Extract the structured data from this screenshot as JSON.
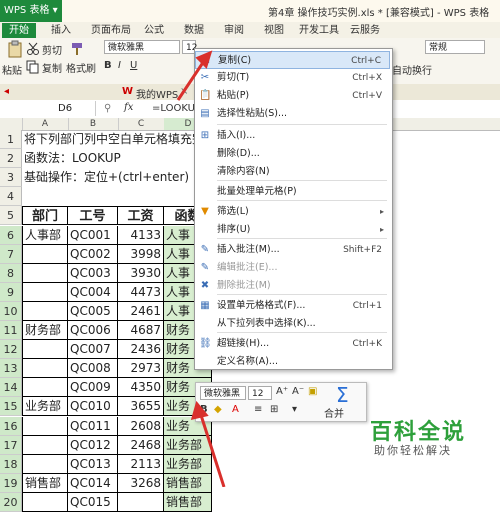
{
  "app": {
    "logo": "WPS 表格",
    "title": "第4章 操作技巧实例.xls * [兼容模式] - WPS 表格"
  },
  "tabs": [
    "开始",
    "插入",
    "页面布局",
    "公式",
    "数据",
    "审阅",
    "视图",
    "开发工具",
    "云服务"
  ],
  "ribbon": {
    "cut": "剪切",
    "paste": "粘贴",
    "copy": "复制",
    "format_painter": "格式刷",
    "font": "微软雅黑",
    "size": "12",
    "number_format": "常规",
    "auto_wrap": "自动换行"
  },
  "docbar": {
    "tab": "我的WPS"
  },
  "formula_bar": {
    "cell_ref": "D6",
    "fx": "fx",
    "formula": "=LOOKUP"
  },
  "columns": [
    "A",
    "B",
    "C",
    "D"
  ],
  "rows": [
    "1",
    "2",
    "3",
    "4",
    "5",
    "6",
    "7",
    "8",
    "9",
    "10",
    "11",
    "12",
    "13",
    "14",
    "15",
    "16",
    "17",
    "18",
    "19",
    "20"
  ],
  "notes": {
    "line1": "将下列部门列中空白单元格填充完成",
    "line2": "函数法：LOOKUP",
    "line3": "基础操作：定位+(ctrl+enter)"
  },
  "table": {
    "headers": [
      "部门",
      "工号",
      "工资",
      "函数"
    ],
    "rows": [
      [
        "人事部",
        "QC001",
        "4133",
        "人事"
      ],
      [
        "",
        "QC002",
        "3998",
        "人事"
      ],
      [
        "",
        "QC003",
        "3930",
        "人事"
      ],
      [
        "",
        "QC004",
        "4473",
        "人事"
      ],
      [
        "",
        "QC005",
        "2461",
        "人事"
      ],
      [
        "财务部",
        "QC006",
        "4687",
        "财务"
      ],
      [
        "",
        "QC007",
        "2436",
        "财务"
      ],
      [
        "",
        "QC008",
        "2973",
        "财务"
      ],
      [
        "",
        "QC009",
        "4350",
        "财务"
      ],
      [
        "业务部",
        "QC010",
        "3655",
        "业务"
      ],
      [
        "",
        "QC011",
        "2608",
        "业务"
      ],
      [
        "",
        "QC012",
        "2468",
        "业务部"
      ],
      [
        "",
        "QC013",
        "2113",
        "业务部"
      ],
      [
        "销售部",
        "QC014",
        "3268",
        "销售部"
      ],
      [
        "",
        "QC015",
        "",
        "销售部"
      ]
    ]
  },
  "context_menu": {
    "items": [
      {
        "label": "复制(C)",
        "shortcut": "Ctrl+C",
        "icon": "copy-icon"
      },
      {
        "label": "剪切(T)",
        "shortcut": "Ctrl+X",
        "icon": "scissors-icon"
      },
      {
        "label": "粘贴(P)",
        "shortcut": "Ctrl+V",
        "icon": "paste-icon"
      },
      {
        "label": "选择性粘贴(S)...",
        "shortcut": "",
        "icon": "paste-special-icon"
      },
      {
        "label": "插入(I)...",
        "shortcut": "",
        "icon": "insert-icon"
      },
      {
        "label": "删除(D)...",
        "shortcut": "",
        "icon": ""
      },
      {
        "label": "清除内容(N)",
        "shortcut": "",
        "icon": ""
      },
      {
        "label": "批量处理单元格(P)",
        "shortcut": "",
        "icon": ""
      },
      {
        "label": "筛选(L)",
        "shortcut": "",
        "icon": "filter-icon"
      },
      {
        "label": "排序(U)",
        "shortcut": "",
        "icon": ""
      },
      {
        "label": "插入批注(M)...",
        "shortcut": "Shift+F2",
        "icon": "comment-icon"
      },
      {
        "label": "编辑批注(E)...",
        "shortcut": "",
        "icon": "edit-comment-icon"
      },
      {
        "label": "删除批注(M)",
        "shortcut": "",
        "icon": "delete-comment-icon"
      },
      {
        "label": "设置单元格格式(F)...",
        "shortcut": "Ctrl+1",
        "icon": "format-cells-icon"
      },
      {
        "label": "从下拉列表中选择(K)...",
        "shortcut": "",
        "icon": ""
      },
      {
        "label": "超链接(H)...",
        "shortcut": "Ctrl+K",
        "icon": "hyperlink-icon"
      },
      {
        "label": "定义名称(A)...",
        "shortcut": "",
        "icon": ""
      }
    ]
  },
  "mini_toolbar": {
    "font": "微软雅黑",
    "size": "12",
    "merge": "合并",
    "sum_icon": "Σ"
  },
  "watermark": {
    "title": "百科全说",
    "subtitle": "助你轻松解决"
  },
  "colors": {
    "wps_green": "#1e8a3c",
    "select_green": "#d8eed0",
    "arrow_red": "#d9302c",
    "watermark_green": "#2ea03b"
  }
}
